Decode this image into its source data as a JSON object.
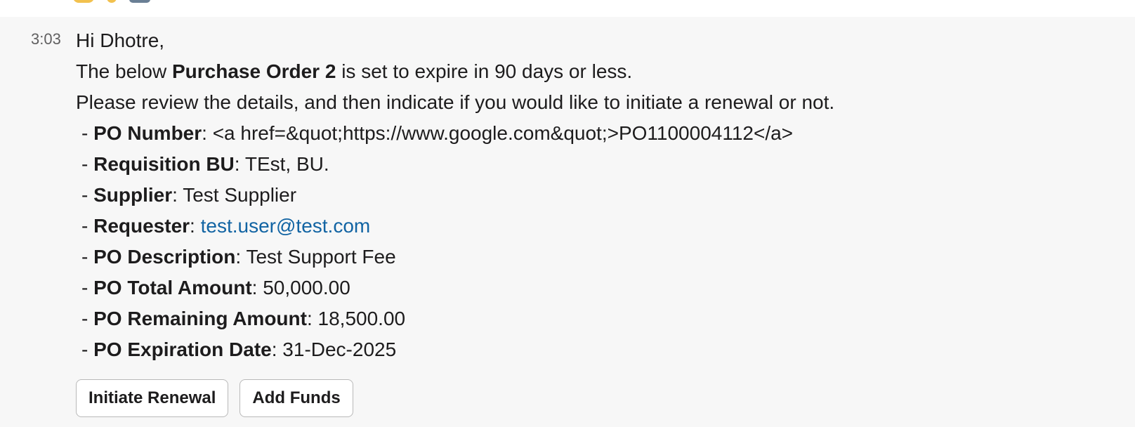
{
  "message": {
    "timestamp": "3:03",
    "greeting": "Hi Dhotre,",
    "intro_prefix": "The below ",
    "intro_bold": "Purchase Order 2",
    "intro_suffix": " is set to expire in 90 days or less.",
    "instruction": "Please review the details, and then indicate if you would like to initiate a renewal or not.",
    "details": [
      {
        "label": "PO Number",
        "value": "<a href=&quot;https://www.google.com&quot;>PO1100004112</a>"
      },
      {
        "label": "Requisition BU",
        "value": "TEst, BU."
      },
      {
        "label": "Supplier",
        "value": "Test Supplier"
      },
      {
        "label": "Requester",
        "value": "test.user@test.com"
      },
      {
        "label": "PO Description",
        "value": "Test Support Fee"
      },
      {
        "label": "PO Total Amount",
        "value": "50,000.00"
      },
      {
        "label": "PO Remaining Amount",
        "value": "18,500.00"
      },
      {
        "label": "PO Expiration Date",
        "value": "31-Dec-2025"
      }
    ],
    "bullet_prefix": "- ",
    "separator": ": "
  },
  "actions": {
    "initiate_renewal": "Initiate Renewal",
    "add_funds": "Add Funds"
  },
  "colors": {
    "link": "#1264a3",
    "message_bg": "#f7f7f7",
    "text": "#1d1c1d"
  }
}
